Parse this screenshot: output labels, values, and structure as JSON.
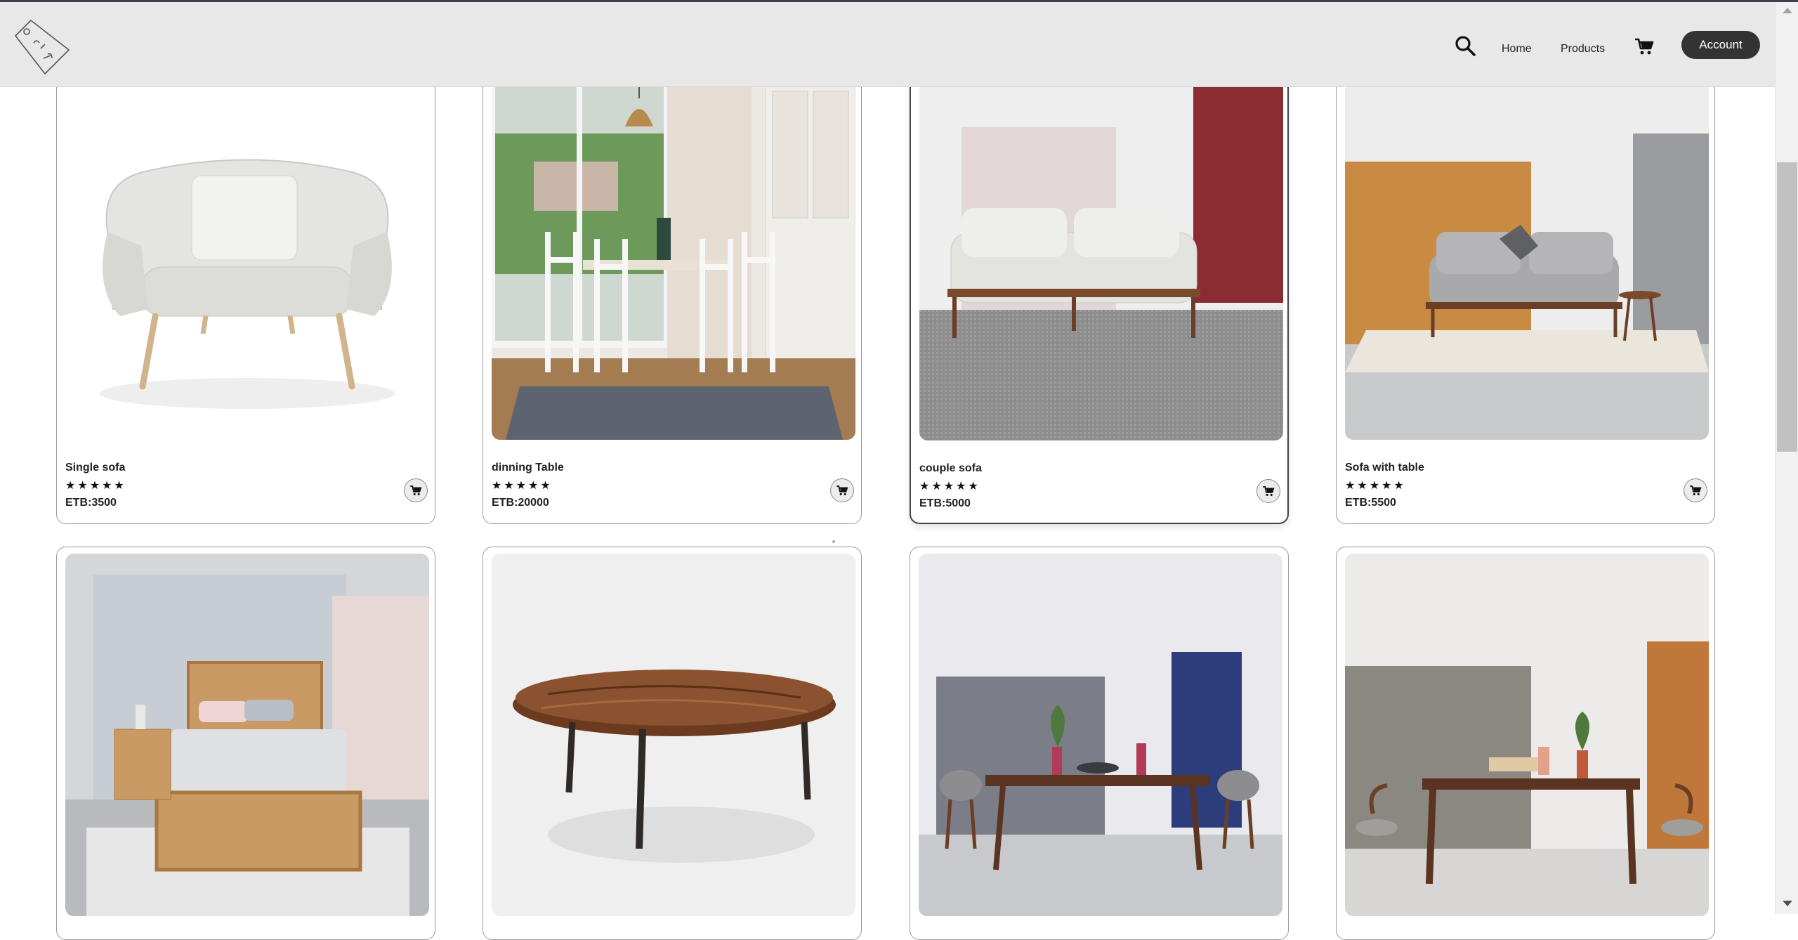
{
  "header": {
    "logo_icon": "price-tag-logo-icon",
    "search_icon": "search-icon",
    "nav": {
      "home": "Home",
      "products": "Products"
    },
    "cart_icon": "cart-icon",
    "account_label": "Account"
  },
  "products": [
    {
      "name": "Single sofa",
      "rating": "★★★★★",
      "price": "ETB:3500",
      "image": "white armchair"
    },
    {
      "name": "dinning Table",
      "rating": "★★★★★",
      "price": "ETB:20000",
      "image": "dining room with white chairs"
    },
    {
      "name": "couple sofa",
      "rating": "★★★★★",
      "price": "ETB:5000",
      "image": "grey loveseat on rug"
    },
    {
      "name": "Sofa with table",
      "rating": "★★★★★",
      "price": "ETB:5500",
      "image": "sofa with side table"
    },
    {
      "name": "",
      "rating": "",
      "price": "",
      "image": "single wooden bed"
    },
    {
      "name": "",
      "rating": "",
      "price": "",
      "image": "round wooden coffee table"
    },
    {
      "name": "",
      "rating": "",
      "price": "",
      "image": "dining table blue panel"
    },
    {
      "name": "",
      "rating": "",
      "price": "",
      "image": "dining table orange panel"
    }
  ],
  "colors": {
    "header_bg": "#e8e8e8",
    "account_bg": "#333333",
    "card_border": "#9a9a9a"
  }
}
